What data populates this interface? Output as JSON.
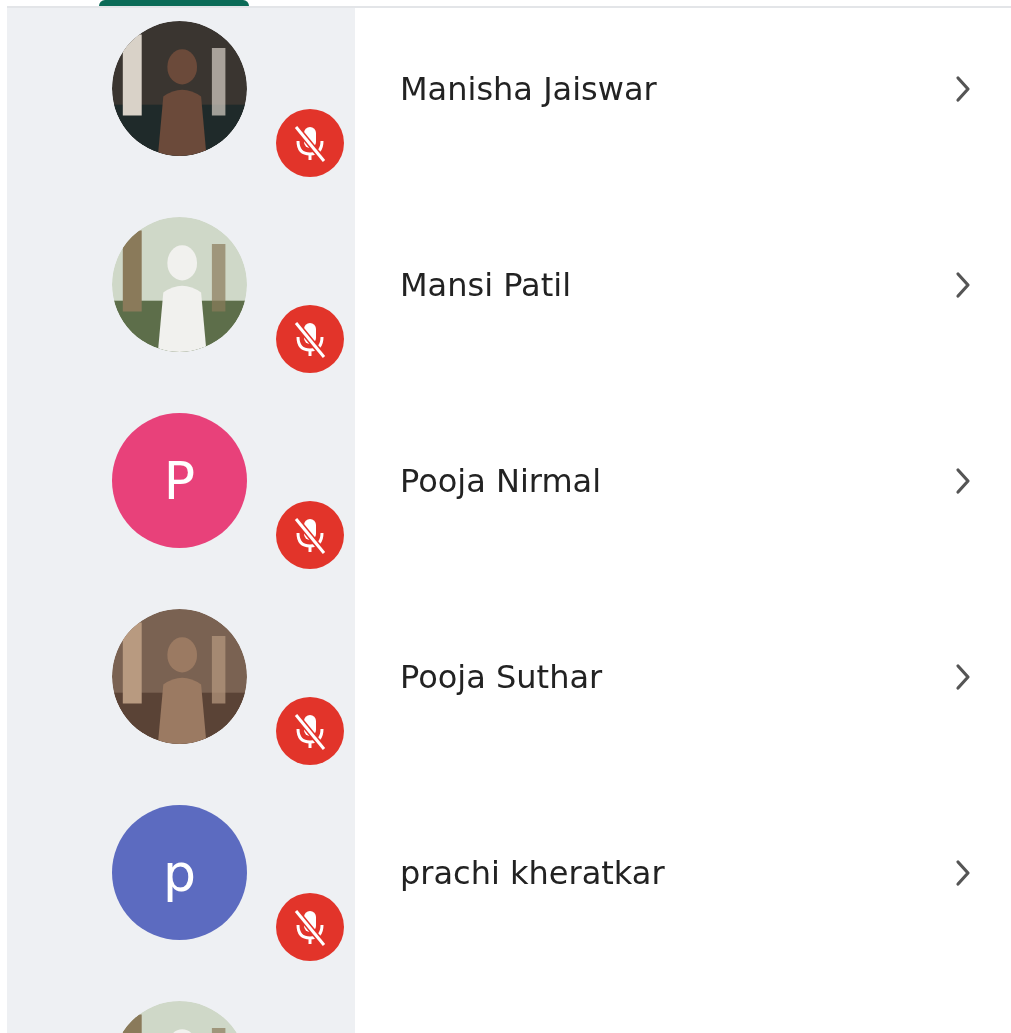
{
  "tabs": [
    {
      "selected": true
    },
    {
      "selected": false
    }
  ],
  "participants": [
    {
      "name": "Manisha Jaiswar",
      "muted": true,
      "avatar": {
        "kind": "picture"
      }
    },
    {
      "name": "Mansi Patil",
      "muted": true,
      "avatar": {
        "kind": "picture"
      }
    },
    {
      "name": "Pooja Nirmal",
      "muted": true,
      "avatar": {
        "kind": "letter",
        "letter": "P",
        "color": "#e8417a"
      }
    },
    {
      "name": "Pooja Suthar",
      "muted": true,
      "avatar": {
        "kind": "picture"
      }
    },
    {
      "name": "prachi kheratkar",
      "muted": true,
      "avatar": {
        "kind": "letter",
        "letter": "p",
        "color": "#5c6bc0"
      }
    },
    {
      "avatar": {
        "kind": "picture"
      }
    }
  ]
}
